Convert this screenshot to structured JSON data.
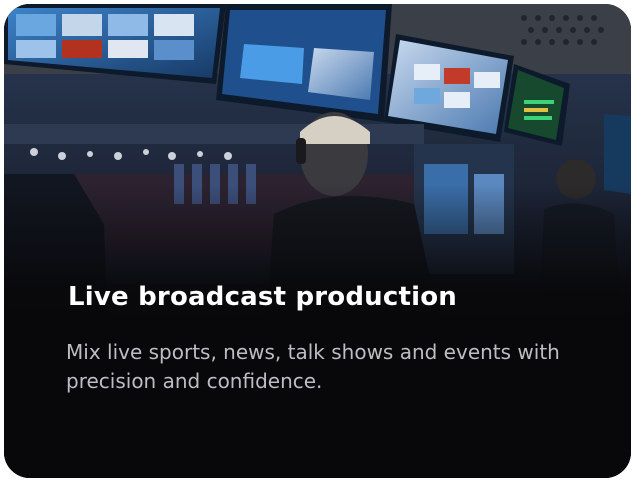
{
  "card": {
    "title": "Live broadcast production",
    "description": "Mix live sports, news, talk shows and events with precision and confidence.",
    "image_subject": "broadcast-control-room-photo"
  },
  "colors": {
    "card_background": "#0a0a0c",
    "title_text": "#ffffff",
    "description_text": "#bdbdc3",
    "monitor_glow": "#2a6fb8"
  }
}
